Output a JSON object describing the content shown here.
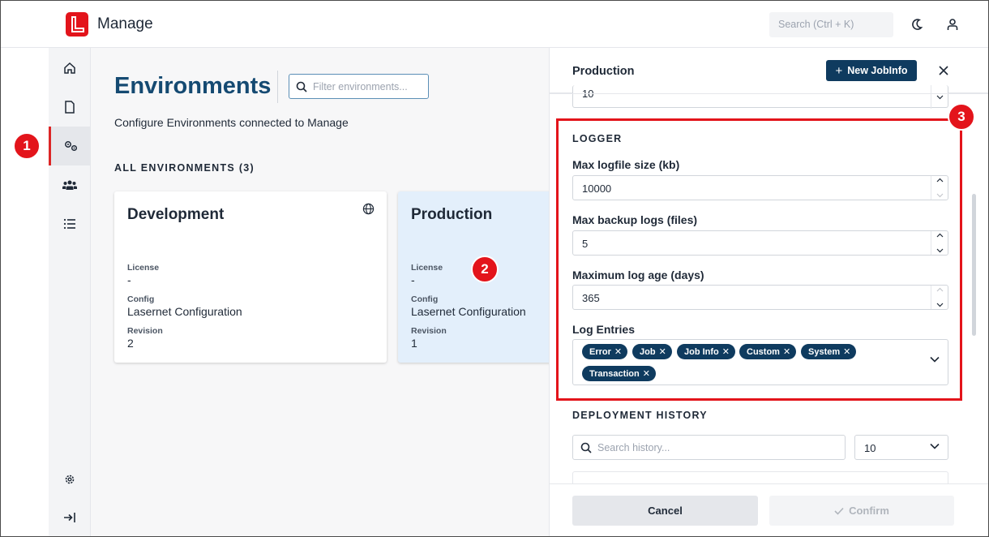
{
  "app": {
    "title": "Manage"
  },
  "header": {
    "search_placeholder": "Search (Ctrl + K)",
    "theme_icon": "moon-icon",
    "user_icon": "user-icon"
  },
  "sidebar": {
    "items": [
      {
        "icon": "home-icon"
      },
      {
        "icon": "document-icon"
      },
      {
        "icon": "gears-icon",
        "active": true
      },
      {
        "icon": "users-icon"
      },
      {
        "icon": "list-icon"
      }
    ],
    "bottom": [
      {
        "icon": "settings-icon"
      },
      {
        "icon": "logout-icon"
      }
    ]
  },
  "main": {
    "title": "Environments",
    "filter_placeholder": "Filter environments...",
    "subtitle": "Configure Environments connected to Manage",
    "section_label": "ALL ENVIRONMENTS (3)",
    "cards": [
      {
        "name": "Development",
        "license_label": "License",
        "license": "-",
        "config_label": "Config",
        "config": "Lasernet Configuration",
        "revision_label": "Revision",
        "revision": "2",
        "globe_icon": true
      },
      {
        "name": "Production",
        "license_label": "License",
        "license": "-",
        "config_label": "Config",
        "config": "Lasernet Configuration",
        "revision_label": "Revision",
        "revision": "1",
        "selected": true
      }
    ]
  },
  "panel": {
    "title": "Production",
    "new_button": "New JobInfo",
    "top_value": "10",
    "logger": {
      "heading": "LOGGER",
      "max_logfile_label": "Max logfile size (kb)",
      "max_logfile_value": "10000",
      "max_backup_label": "Max backup logs (files)",
      "max_backup_value": "5",
      "max_age_label": "Maximum log age (days)",
      "max_age_value": "365",
      "entries_label": "Log Entries",
      "entries": [
        "Error",
        "Job",
        "Job Info",
        "Custom",
        "System",
        "Transaction"
      ]
    },
    "history": {
      "heading": "DEPLOYMENT HISTORY",
      "search_placeholder": "Search history...",
      "page_size": "10"
    },
    "cancel_label": "Cancel",
    "confirm_label": "Confirm"
  },
  "annotations": {
    "badge1": "1",
    "badge2": "2",
    "badge3": "3"
  },
  "colors": {
    "brand": "#e3141b",
    "primary": "#0f3b5f",
    "title": "#154a72"
  }
}
